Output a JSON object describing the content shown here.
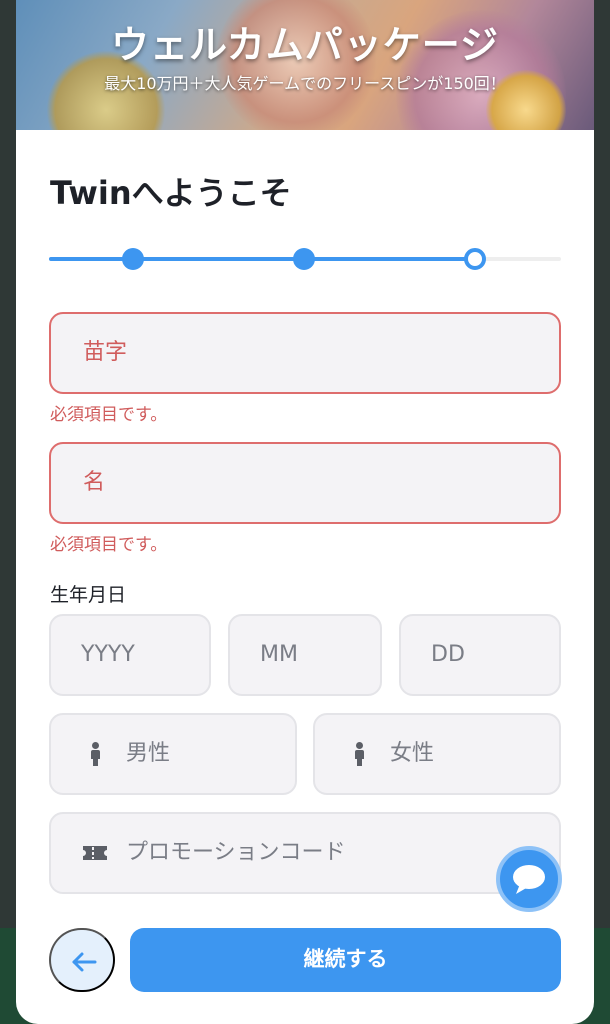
{
  "banner": {
    "title": "ウェルカムパッケージ",
    "subtitle": "最大10万円＋大人気ゲームでのフリースピンが150回！"
  },
  "heading": "Twinへようこそ",
  "stepper": {
    "total_steps": 3,
    "current_step": 3
  },
  "form": {
    "last_name_placeholder": "苗字",
    "first_name_placeholder": "名",
    "required_error": "必須項目です。",
    "birthdate_label": "生年月日",
    "year_placeholder": "YYYY",
    "month_placeholder": "MM",
    "day_placeholder": "DD",
    "gender_male": "男性",
    "gender_female": "女性",
    "promo_placeholder": "プロモーションコード"
  },
  "footer": {
    "continue_label": "継続する"
  },
  "icons": {
    "back": "arrow-left-icon",
    "male": "person-icon",
    "female": "person-icon",
    "promo": "ticket-icon",
    "chat": "chat-icon"
  },
  "colors": {
    "accent": "#3d96f0",
    "error": "#d05c5c",
    "field_bg": "#f4f3f6"
  }
}
